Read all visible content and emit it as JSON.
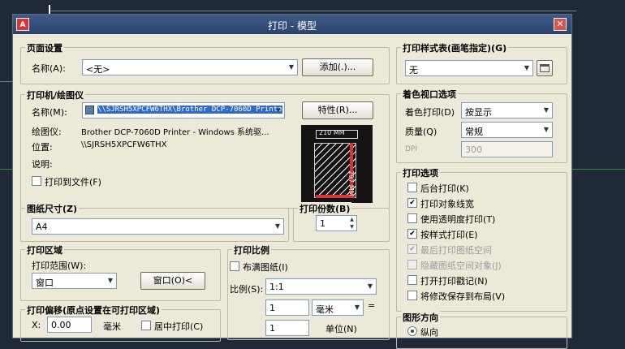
{
  "window": {
    "title": "打印 - 模型",
    "app_icon": "A",
    "close_glyph": "✕"
  },
  "page_setup": {
    "group": "页面设置",
    "name_label": "名称(A):",
    "name_value": "<无>",
    "add_button": "添加(.)..."
  },
  "printer": {
    "group": "打印机/绘图仪",
    "name_label": "名称(M):",
    "name_value": "\\\\SJRSH5XPCFW6THX\\Brother DCP-7060D Printe",
    "properties_button": "特性(R)...",
    "plotter_label": "绘图仪:",
    "plotter_value": "Brother DCP-7060D Printer - Windows 系统驱...",
    "location_label": "位置:",
    "location_value": "\\\\SJRSH5XPCFW6THX",
    "desc_label": "说明:",
    "print_to_file": "打印到文件(F)",
    "preview": {
      "width_label": "210 MM",
      "height_label": "297 MM"
    }
  },
  "paper_size": {
    "group": "图纸尺寸(Z)",
    "value": "A4"
  },
  "copies": {
    "group": "打印份数(B)",
    "value": "1"
  },
  "plot_area": {
    "group": "打印区域",
    "range_label": "打印范围(W):",
    "range_value": "窗口",
    "window_button": "窗口(O)<"
  },
  "plot_scale": {
    "group": "打印比例",
    "fit_paper": "布满图纸(I)",
    "scale_label": "比例(S):",
    "scale_value": "1:1",
    "value1": "1",
    "unit": "毫米",
    "value2": "1",
    "units_label": "单位(N)"
  },
  "plot_offset": {
    "group": "打印偏移(原点设置在可打印区域)",
    "x_label": "X:",
    "x_value": "0.00",
    "x_unit": "毫米",
    "center": "居中打印(C)"
  },
  "style_table": {
    "group": "打印样式表(画笔指定)(G)",
    "value": "无"
  },
  "shaded_viewport": {
    "group": "着色视口选项",
    "shade_label": "着色打印(D)",
    "shade_value": "按显示",
    "quality_label": "质量(Q)",
    "quality_value": "常规",
    "dpi_label": "DPI",
    "dpi_value": "300"
  },
  "plot_options": {
    "group": "打印选项",
    "items": [
      {
        "label": "后台打印(K)",
        "checked": false,
        "disabled": false
      },
      {
        "label": "打印对象线宽",
        "checked": true,
        "disabled": false
      },
      {
        "label": "使用透明度打印(T)",
        "checked": false,
        "disabled": false
      },
      {
        "label": "按样式打印(E)",
        "checked": true,
        "disabled": false
      },
      {
        "label": "最后打印图纸空间",
        "checked": true,
        "disabled": true
      },
      {
        "label": "隐藏图纸空间对象(J)",
        "checked": false,
        "disabled": true
      },
      {
        "label": "打开打印戳记(N)",
        "checked": false,
        "disabled": false
      },
      {
        "label": "将修改保存到布局(V)",
        "checked": false,
        "disabled": false
      }
    ]
  },
  "orientation": {
    "group": "图形方向",
    "portrait": "纵向"
  }
}
